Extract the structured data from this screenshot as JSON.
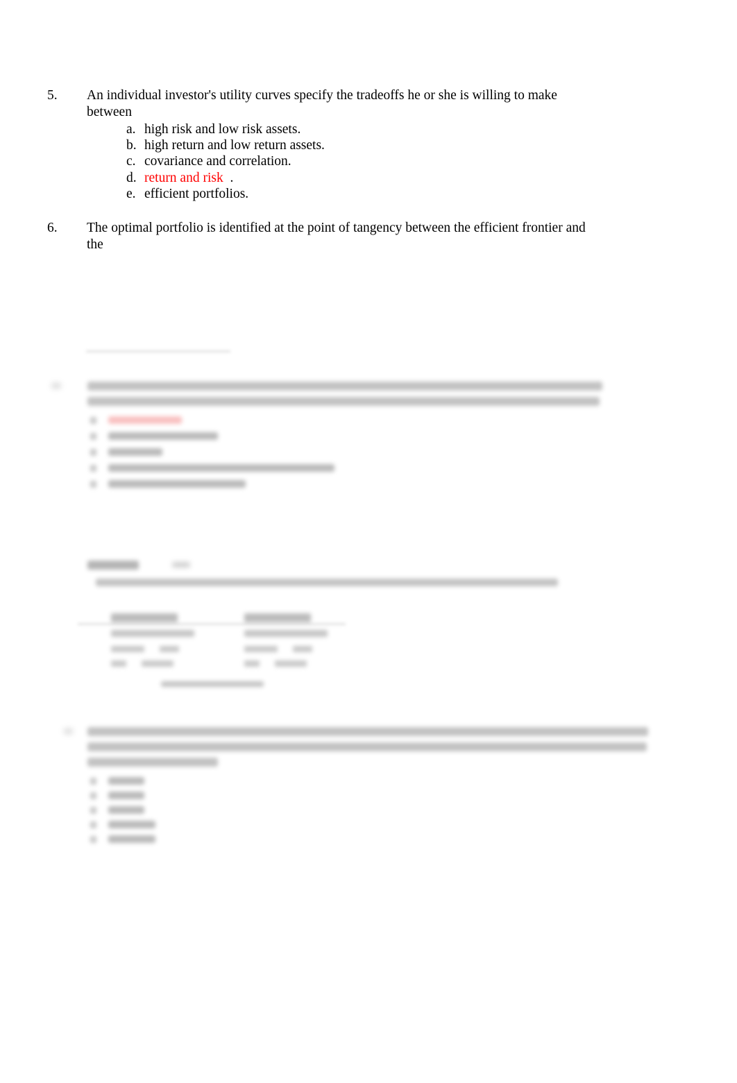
{
  "document": {
    "type": "multiple-choice exam page",
    "subject": "Investment / Portfolio Theory",
    "page_background": "#ffffff",
    "answer_highlight_color": "#ff0000"
  },
  "questions": [
    {
      "number": "5.",
      "stem": "An individual investor's utility curves specify the tradeoffs he or she is willing to make between",
      "options": [
        {
          "letter": "a.",
          "text": "high risk and low risk assets.",
          "answer": false
        },
        {
          "letter": "b.",
          "text": "high return and low return assets.",
          "answer": false
        },
        {
          "letter": "c.",
          "text": "covariance and correlation.",
          "answer": false
        },
        {
          "letter": "d.",
          "text": "return and risk  ",
          "trailing": ".",
          "answer": true
        },
        {
          "letter": "e.",
          "text": "efficient portfolios.",
          "answer": false
        }
      ]
    },
    {
      "number": "6.",
      "stem": "The optimal portfolio is identified at the point of tangency between the efficient frontier and the",
      "options": []
    }
  ],
  "redacted": {
    "note": "Remaining page content is visually blurred and unreadable in the source image.",
    "blocks": [
      {
        "kind": "answer-blank-rule"
      },
      {
        "kind": "question-with-options",
        "option_count": 5,
        "first_option_highlighted": true
      },
      {
        "kind": "exhibit-heading"
      },
      {
        "kind": "exhibit-data-tables",
        "column_count": 2
      },
      {
        "kind": "question-with-options",
        "option_count": 5,
        "first_option_highlighted": false
      }
    ]
  }
}
